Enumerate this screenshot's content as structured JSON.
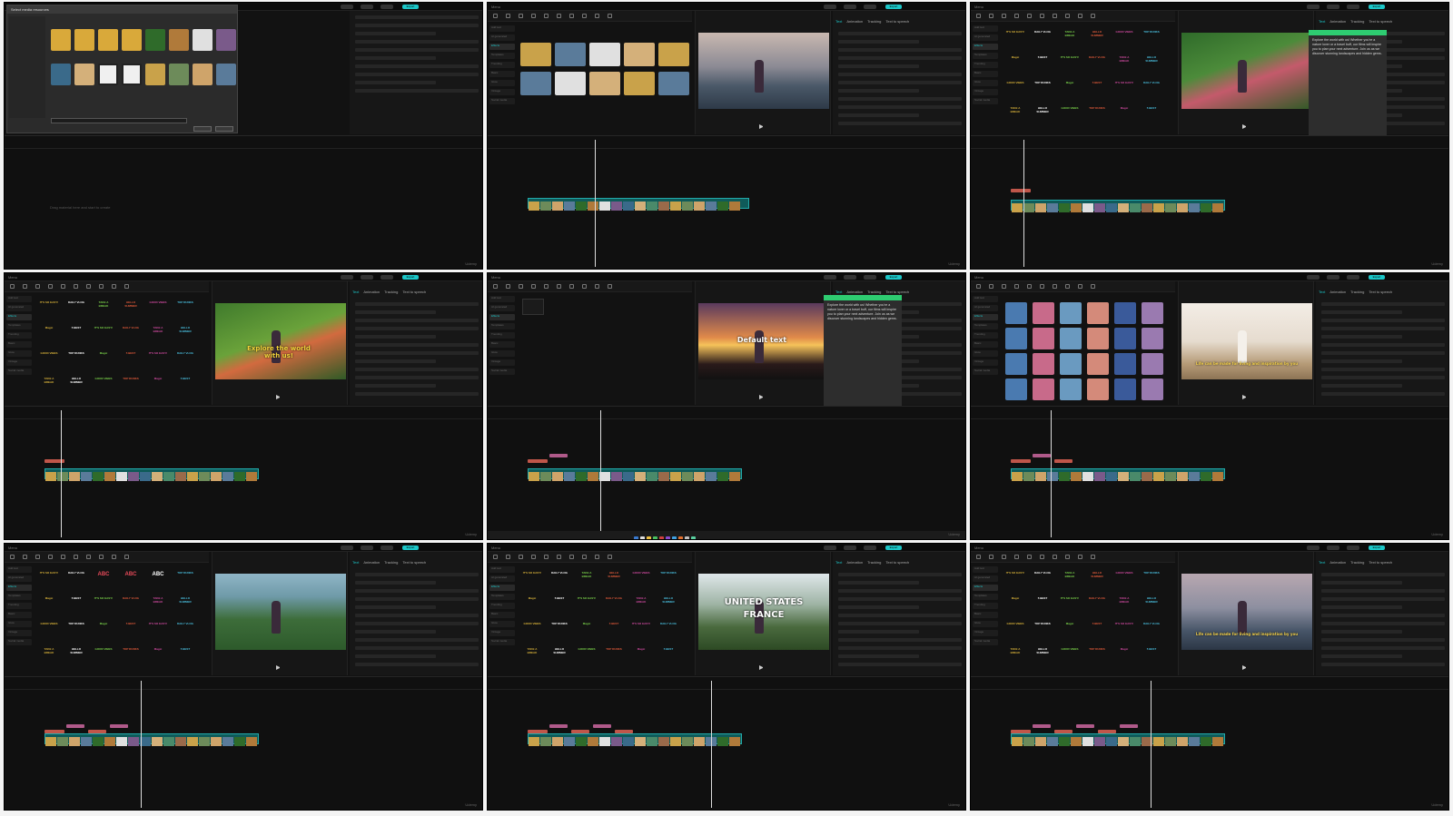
{
  "cells": [
    {
      "id": "import-dialog",
      "dialog_title": "Select media resources",
      "empty_timeline_hint": "Drag material here and start to create",
      "watermark": "Udemy",
      "export_label": "Export"
    },
    {
      "id": "media-library",
      "player_label": "Player",
      "watermark": "Udemy",
      "export_label": "Export"
    },
    {
      "id": "text-ai-panel",
      "ai_text": "Explore the world with us! Whether you're a nature lover or a travel buff, our films will inspire you to plan your next adventure. Join us as we discover stunning landscapes and hidden gems.",
      "watermark": "Udemy",
      "export_label": "Export"
    },
    {
      "id": "text-on-video",
      "overlay_text": "Explore the world with us!",
      "watermark": "Udemy",
      "export_label": "Export"
    },
    {
      "id": "default-text",
      "overlay_text": "Default text",
      "watermark": "Udemy",
      "export_label": "Export"
    },
    {
      "id": "caption-templates",
      "caption_text": "Life can be made for living and inspiration by you",
      "watermark": "Udemy",
      "export_label": "Export"
    },
    {
      "id": "text-effects",
      "effect_words": [
        "ABC",
        "ABC",
        "ABC"
      ],
      "watermark": "Udemy",
      "export_label": "Export"
    },
    {
      "id": "title-us-france",
      "title_line1": "UNITED STATES",
      "title_line2": "FRANCE",
      "watermark": "Udemy",
      "export_label": "Export"
    },
    {
      "id": "caption-styles",
      "caption_text": "Life can be made for living and inspiration by you",
      "watermark": "Udemy",
      "export_label": "Export"
    }
  ],
  "common": {
    "menu_label": "Menu",
    "sidebar_items": [
      "Add text",
      "AI generated",
      "Effects",
      "Templates",
      "Trending",
      "Basic",
      "Glow",
      "Vintage",
      "Social media"
    ],
    "prop_tabs": [
      "Text",
      "Animation",
      "Tracking",
      "Text to speech"
    ],
    "sticker_words": [
      "IT'S SO EASY!",
      "DAILY VLOG",
      "TAKE A BREAK",
      "HELLO SUMMER",
      "GOOD VIBES",
      "TOP DUNKS",
      "Magic",
      "5 BEST"
    ]
  }
}
